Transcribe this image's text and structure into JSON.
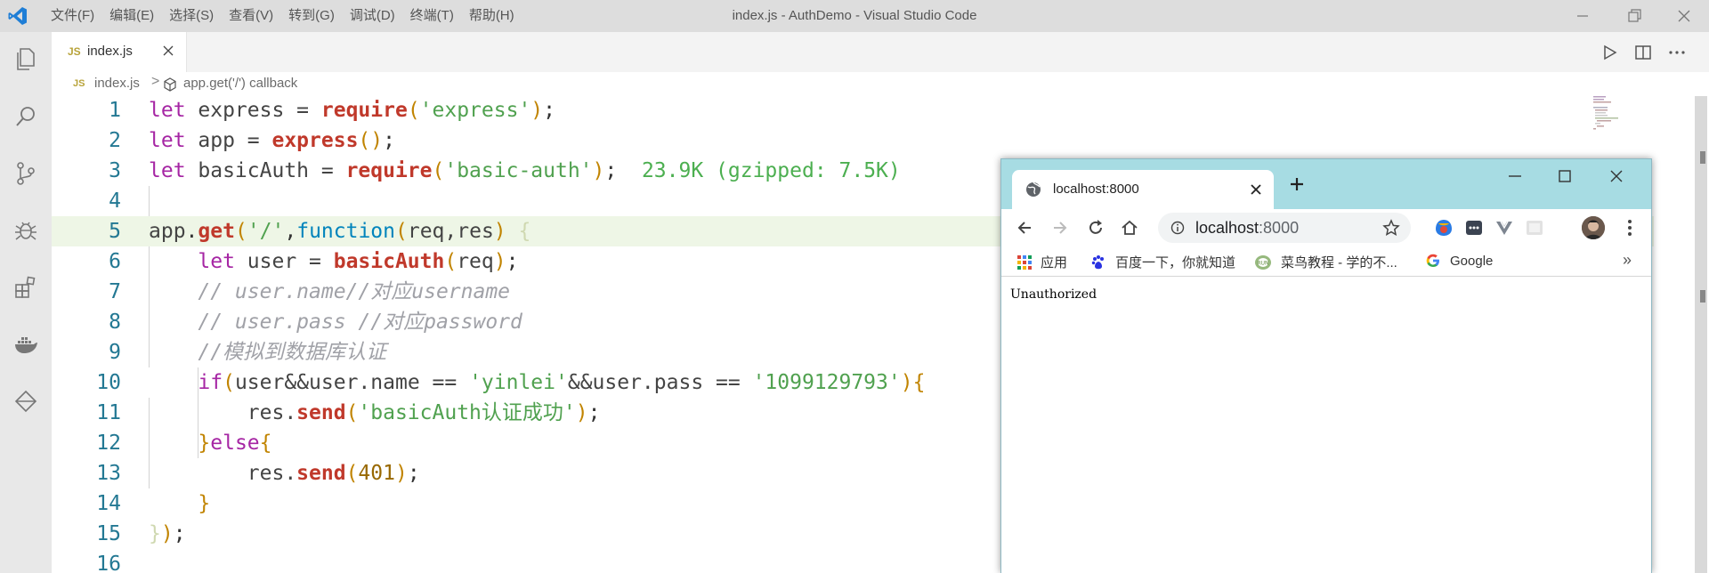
{
  "vscode": {
    "menu": [
      "文件(F)",
      "编辑(E)",
      "选择(S)",
      "查看(V)",
      "转到(G)",
      "调试(D)",
      "终端(T)",
      "帮助(H)"
    ],
    "window_title": "index.js - AuthDemo - Visual Studio Code",
    "tab": {
      "badge": "JS",
      "name": "index.js"
    },
    "breadcrumb": {
      "badge": "JS",
      "file": "index.js",
      "separator": ">",
      "symbol": "app.get('/') callback"
    },
    "line_numbers": [
      "1",
      "2",
      "3",
      "4",
      "5",
      "6",
      "7",
      "8",
      "9",
      "10",
      "11",
      "12",
      "13",
      "14",
      "15",
      "16"
    ],
    "code": {
      "l1": {
        "let": "let",
        "id": " express = ",
        "fn": "require",
        "p1": "(",
        "s": "'express'",
        "p2": ")",
        "end": ";"
      },
      "l2": {
        "let": "let",
        "id": " app = ",
        "fn": "express",
        "p": "()",
        "end": ";"
      },
      "l3": {
        "let": "let",
        "id": " basicAuth = ",
        "fn": "require",
        "p1": "(",
        "s": "'basic-auth'",
        "p2": ")",
        "end": ";",
        "hint": "23.9K (gzipped: 7.5K)"
      },
      "l5": {
        "obj": "app",
        "dot": ".",
        "fn": "get",
        "p1": "(",
        "s": "'/'",
        "comma": ",",
        "kw": "function",
        "p2": "(",
        "params": "req,res",
        "p3": ")",
        "brace": " {"
      },
      "l6": {
        "let": "let",
        "id": " user = ",
        "fn": "basicAuth",
        "p1": "(",
        "arg": "req",
        "p2": ")",
        "end": ";"
      },
      "l7": {
        "comment": "// user.name//对应username"
      },
      "l8": {
        "comment": "// user.pass //对应password"
      },
      "l9": {
        "comment": "//模拟到数据库认证"
      },
      "l10": {
        "kw": "if",
        "p1": "(",
        "a": "user&&user.name == ",
        "s1": "'yinlei'",
        "b": "&&user.pass == ",
        "s2": "'1099129793'",
        "p2": ")",
        "brace": "{"
      },
      "l11": {
        "obj": "res.",
        "fn": "send",
        "p1": "(",
        "s": "'basicAuth认证成功'",
        "p2": ")",
        "end": ";"
      },
      "l12": {
        "b1": "}",
        "kw": "else",
        "b2": "{"
      },
      "l13": {
        "obj": "res.",
        "fn": "send",
        "p1": "(",
        "num": "401",
        "p2": ")",
        "end": ";"
      },
      "l14": {
        "brace": "}"
      },
      "l15": {
        "brace": "}",
        "p": ")",
        "end": ";"
      }
    }
  },
  "browser": {
    "tab_title": "localhost:8000",
    "url_host": "localhost",
    "url_port": ":8000",
    "bookmarks": [
      "应用",
      "百度一下，你就知道",
      "菜鸟教程 - 学的不...",
      "Google"
    ],
    "bookmarks_more": "»",
    "page_text": "Unauthorized"
  },
  "colors": {
    "accent": "#007acc",
    "chrome_frame": "#a7dce3",
    "line_highlight": "#eef6e6"
  }
}
